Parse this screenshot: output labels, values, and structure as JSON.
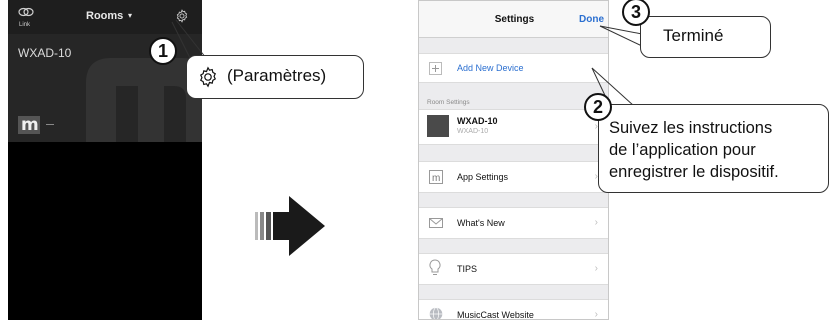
{
  "left_app": {
    "link_label": "Link",
    "rooms_title": "Rooms",
    "room_name": "WXAD-10"
  },
  "callouts": {
    "step1": {
      "number": "1",
      "text": "(Paramètres)"
    },
    "step2": {
      "number": "2",
      "lines": [
        "Suivez les instructions",
        "de l’application pour",
        "enregistrer le dispositif."
      ]
    },
    "step3": {
      "number": "3",
      "text": "Terminé"
    }
  },
  "settings": {
    "title": "Settings",
    "done": "Done",
    "add_device": "Add New Device",
    "section_room": "Room Settings",
    "device_name": "WXAD-10",
    "device_sub": "WXAD-10",
    "items": [
      {
        "label": "App Settings",
        "icon": "m-logo-icon"
      },
      {
        "label": "What's New",
        "icon": "envelope-icon"
      },
      {
        "label": "TIPS",
        "icon": "lightbulb-icon"
      },
      {
        "label": "MusicCast Website",
        "icon": "globe-icon"
      }
    ]
  },
  "colors": {
    "accent_blue": "#2b6fd0",
    "arrow": "#1a1a1a"
  }
}
